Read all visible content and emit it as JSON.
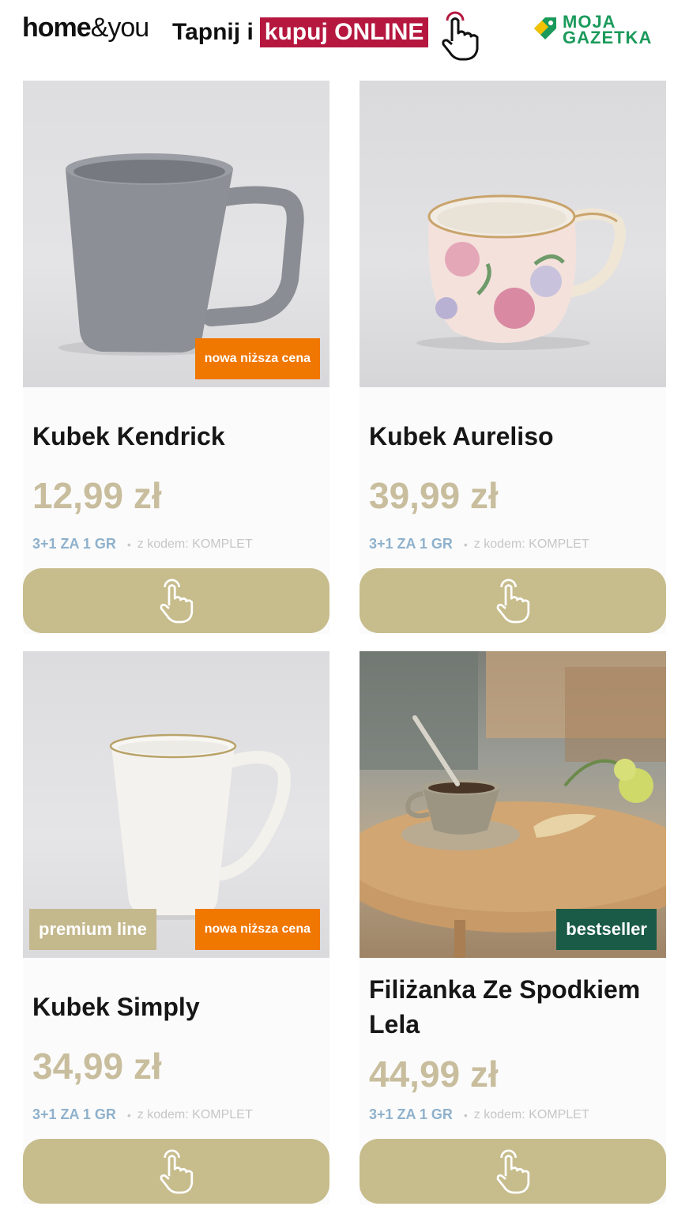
{
  "header": {
    "logo_home_bold": "home",
    "logo_home_thin": "&you",
    "promo_prefix": "Tapnij i",
    "promo_highlight": "kupuj ONLINE",
    "moja_gazetka_line1": "MOJA",
    "moja_gazetka_line2": "GAZETKA"
  },
  "colors": {
    "price": "#c8bd9d",
    "cta": "#c7bc8c",
    "orange_badge": "#f07700",
    "green_badge": "#1a5b48",
    "promo_pill": "#b5173f"
  },
  "products": [
    {
      "title": "Kubek Kendrick",
      "price": "12,99 zł",
      "deal": "3+1 ZA 1 GR",
      "code": "z kodem: KOMPLET",
      "badge_right": "nowa niższa cena",
      "cta_icon": "tap-icon"
    },
    {
      "title": "Kubek Aureliso",
      "price": "39,99 zł",
      "deal": "3+1 ZA 1 GR",
      "code": "z kodem: KOMPLET",
      "cta_icon": "tap-icon"
    },
    {
      "title": "Kubek Simply",
      "price": "34,99 zł",
      "deal": "3+1 ZA 1 GR",
      "code": "z kodem: KOMPLET",
      "badge_left": "premium line",
      "badge_right": "nowa niższa cena",
      "cta_icon": "tap-icon"
    },
    {
      "title_line1": "Filiżanka Ze Spodkiem",
      "title_line2": "Lela",
      "price": "44,99 zł",
      "deal": "3+1 ZA 1 GR",
      "code": "z kodem: KOMPLET",
      "badge_right": "bestseller",
      "cta_icon": "tap-icon"
    }
  ]
}
